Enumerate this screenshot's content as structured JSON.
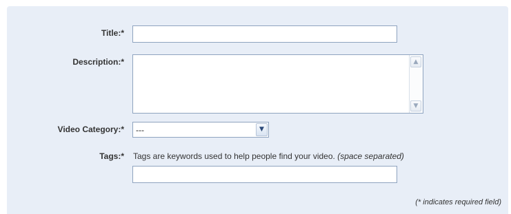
{
  "form": {
    "title": {
      "label": "Title:*",
      "value": ""
    },
    "description": {
      "label": "Description:*",
      "value": "",
      "scroll_up_icon": "triangle-up",
      "scroll_down_icon": "triangle-down"
    },
    "video_category": {
      "label": "Video Category:*",
      "selected": "---",
      "dropdown_icon": "chevron-down"
    },
    "tags": {
      "label": "Tags:*",
      "help_text": "Tags are keywords used to help people find your video.",
      "help_hint": "(space separated)",
      "value": ""
    },
    "required_note": "(* indicates required field)"
  },
  "colors": {
    "panel_background": "#e8eef7",
    "input_border": "#8ea3bf"
  }
}
